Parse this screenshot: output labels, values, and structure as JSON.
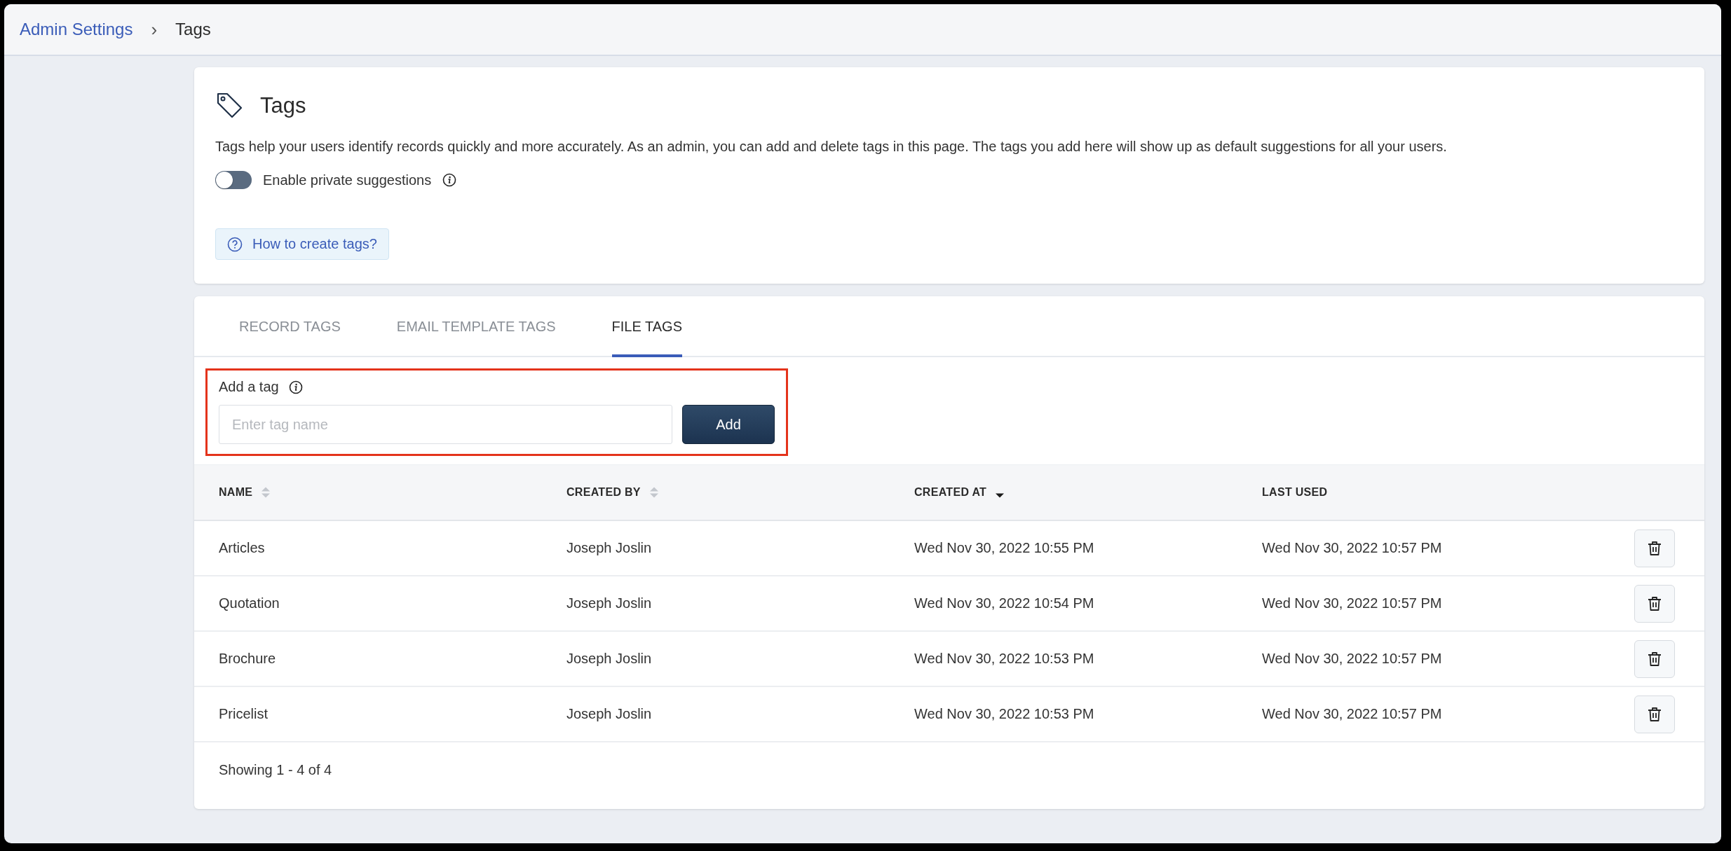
{
  "breadcrumb": {
    "parent": "Admin Settings",
    "separator": "›",
    "current": "Tags"
  },
  "intro": {
    "title": "Tags",
    "description": "Tags help your users identify records quickly and more accurately. As an admin, you can add and delete tags in this page. The tags you add here will show up as default suggestions for all your users.",
    "toggle": {
      "label": "Enable private suggestions",
      "on": false
    },
    "help_button": "How to create tags?"
  },
  "tabs": [
    {
      "label": "RECORD TAGS",
      "selected": false
    },
    {
      "label": "EMAIL TEMPLATE TAGS",
      "selected": false
    },
    {
      "label": "FILE TAGS",
      "selected": true
    }
  ],
  "add_tag": {
    "label": "Add a tag",
    "placeholder": "Enter tag name",
    "button": "Add",
    "highlighted": true
  },
  "table": {
    "columns": [
      {
        "label": "NAME",
        "sortable": true,
        "sorted_desc": false
      },
      {
        "label": "CREATED BY",
        "sortable": true,
        "sorted_desc": false
      },
      {
        "label": "CREATED AT",
        "sortable": true,
        "sorted_desc": true
      },
      {
        "label": "LAST USED",
        "sortable": false
      }
    ],
    "rows": [
      {
        "name": "Articles",
        "created_by": "Joseph Joslin",
        "created_at": "Wed Nov 30, 2022 10:55 PM",
        "last_used": "Wed Nov 30, 2022 10:57 PM"
      },
      {
        "name": "Quotation",
        "created_by": "Joseph Joslin",
        "created_at": "Wed Nov 30, 2022 10:54 PM",
        "last_used": "Wed Nov 30, 2022 10:57 PM"
      },
      {
        "name": "Brochure",
        "created_by": "Joseph Joslin",
        "created_at": "Wed Nov 30, 2022 10:53 PM",
        "last_used": "Wed Nov 30, 2022 10:57 PM"
      },
      {
        "name": "Pricelist",
        "created_by": "Joseph Joslin",
        "created_at": "Wed Nov 30, 2022 10:53 PM",
        "last_used": "Wed Nov 30, 2022 10:57 PM"
      }
    ],
    "footer": "Showing 1 - 4 of 4"
  }
}
